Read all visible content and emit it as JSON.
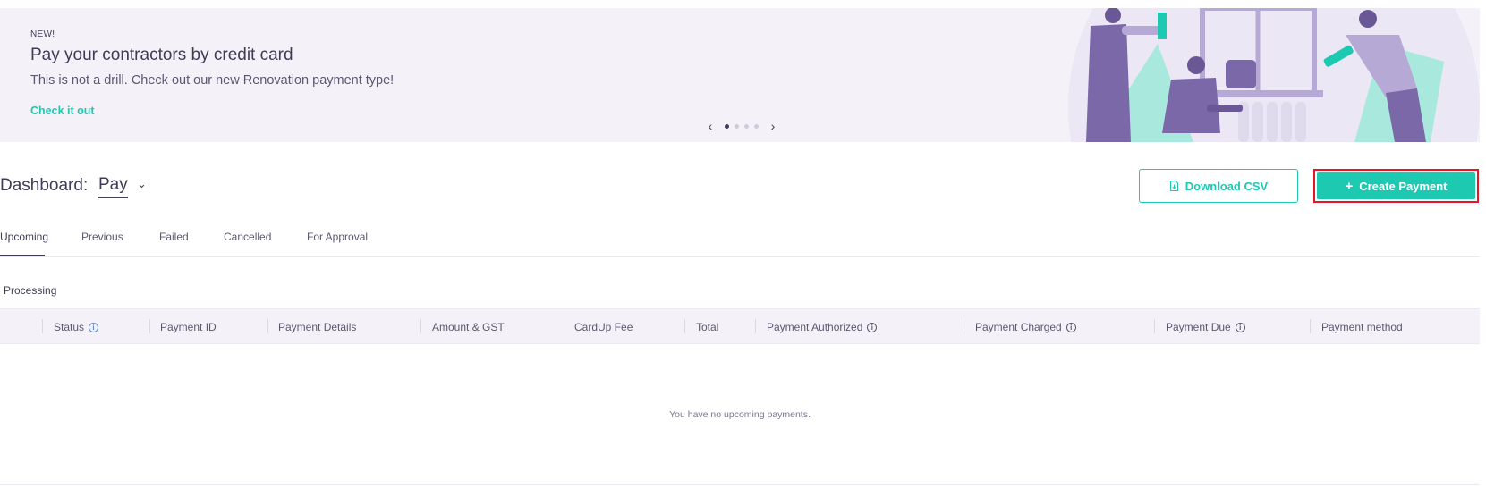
{
  "banner": {
    "badge": "NEW!",
    "title": "Pay your contractors by credit card",
    "subtitle": "This is not a drill. Check out our new Renovation payment type!",
    "link": "Check it out",
    "prev_arrow": "‹",
    "next_arrow": "›",
    "slides_total": 4,
    "slide_active": 1
  },
  "header": {
    "dashboard_label": "Dashboard:",
    "dashboard_value": "Pay",
    "chevron": "⌄"
  },
  "actions": {
    "download_csv": "Download CSV",
    "create_payment": "Create Payment",
    "plus": "+"
  },
  "tabs": [
    {
      "label": "Upcoming",
      "active": true
    },
    {
      "label": "Previous",
      "active": false
    },
    {
      "label": "Failed",
      "active": false
    },
    {
      "label": "Cancelled",
      "active": false
    },
    {
      "label": "For Approval",
      "active": false
    }
  ],
  "section": {
    "label": "Processing"
  },
  "table": {
    "columns": [
      {
        "label": "Status",
        "info": true
      },
      {
        "label": "Payment ID",
        "info": false
      },
      {
        "label": "Payment Details",
        "info": false
      },
      {
        "label": "Amount & GST",
        "info": false
      },
      {
        "label": "CardUp Fee",
        "info": false
      },
      {
        "label": "Total",
        "info": false
      },
      {
        "label": "Payment Authorized",
        "info": true
      },
      {
        "label": "Payment Charged",
        "info": true
      },
      {
        "label": "Payment Due",
        "info": true
      },
      {
        "label": "Payment method",
        "info": false
      }
    ],
    "empty_message": "You have no upcoming payments."
  },
  "colors": {
    "accent": "#1dc9b1",
    "text": "#3f3d56",
    "highlight": "#e4162a",
    "banner_bg": "#f4f2f8"
  }
}
